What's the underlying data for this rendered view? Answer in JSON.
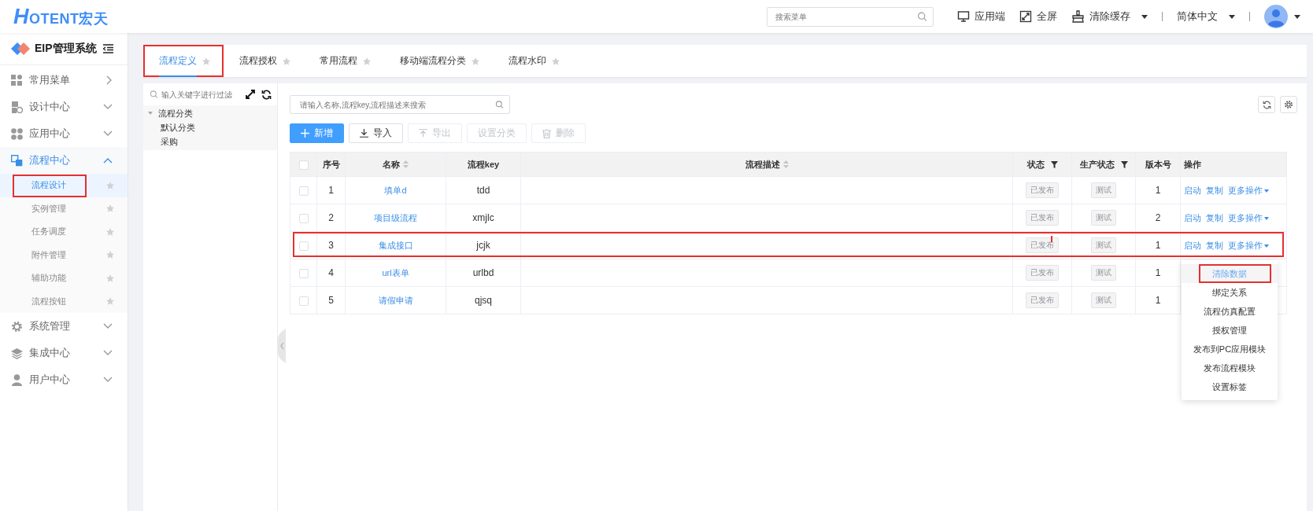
{
  "header": {
    "logo": "HOTENT宏天",
    "search": {
      "placeholder": "搜索菜单"
    },
    "actions": [
      {
        "label": "应用端",
        "kind": "button"
      },
      {
        "label": "全屏",
        "kind": "button"
      },
      {
        "label": "清除缓存",
        "kind": "menu"
      }
    ],
    "language": {
      "label": "简体中文",
      "expanded": false
    }
  },
  "sidebar": {
    "title": "EIP管理系统",
    "items": [
      {
        "label": "常用菜单",
        "kind": "flyout",
        "expanded": false
      },
      {
        "label": "设计中心",
        "kind": "group",
        "expanded": false
      },
      {
        "label": "应用中心",
        "kind": "group",
        "expanded": false
      },
      {
        "label": "流程中心",
        "kind": "group",
        "expanded": true,
        "children": [
          {
            "label": "流程设计",
            "selected": true,
            "highlighted": true
          },
          {
            "label": "实例管理",
            "selected": false,
            "highlighted": false
          },
          {
            "label": "任务调度",
            "selected": false,
            "highlighted": false
          },
          {
            "label": "附件管理",
            "selected": false,
            "highlighted": false
          },
          {
            "label": "辅助功能",
            "selected": false,
            "highlighted": false
          },
          {
            "label": "流程按钮",
            "selected": false,
            "highlighted": false
          }
        ]
      },
      {
        "label": "系统管理",
        "kind": "group",
        "expanded": false
      },
      {
        "label": "集成中心",
        "kind": "group",
        "expanded": false
      },
      {
        "label": "用户中心",
        "kind": "group",
        "expanded": false
      }
    ]
  },
  "tabs": [
    {
      "label": "流程定义",
      "selected": true,
      "highlighted": true
    },
    {
      "label": "流程授权",
      "selected": false,
      "highlighted": false
    },
    {
      "label": "常用流程",
      "selected": false,
      "highlighted": false
    },
    {
      "label": "移动端流程分类",
      "selected": false,
      "highlighted": false
    },
    {
      "label": "流程水印",
      "selected": false,
      "highlighted": false
    }
  ],
  "tree": {
    "filter": {
      "placeholder": "输入关键字进行过滤"
    },
    "nodes": [
      {
        "label": "流程分类",
        "expanded": true,
        "children": [
          {
            "label": "默认分类"
          },
          {
            "label": "采购"
          }
        ]
      }
    ]
  },
  "table": {
    "search": {
      "placeholder": "请输入名称,流程key,流程描述来搜索"
    },
    "toolbar": [
      {
        "label": "新增",
        "kind": "primary",
        "disabled": false
      },
      {
        "label": "导入",
        "kind": "default",
        "disabled": false
      },
      {
        "label": "导出",
        "kind": "default",
        "disabled": true
      },
      {
        "label": "设置分类",
        "kind": "default",
        "disabled": true
      },
      {
        "label": "删除",
        "kind": "default",
        "disabled": true
      }
    ],
    "columns": [
      {
        "kind": "checkbox",
        "checked": false
      },
      {
        "label": "序号",
        "kind": "plain"
      },
      {
        "label": "名称",
        "kind": "sortable"
      },
      {
        "label": "流程key",
        "kind": "plain"
      },
      {
        "label": "流程描述",
        "kind": "sortable"
      },
      {
        "label": "状态",
        "kind": "filter"
      },
      {
        "label": "生产状态",
        "kind": "filter"
      },
      {
        "label": "版本号",
        "kind": "plain"
      },
      {
        "label": "操作",
        "kind": "plain"
      }
    ],
    "rows": [
      {
        "checked": false,
        "index": "1",
        "name": "填单d",
        "key": "tdd",
        "status": "已发布",
        "production": "测试",
        "version": "1",
        "actions": [
          "启动",
          "复制",
          "更多操作"
        ],
        "highlighted": false
      },
      {
        "checked": false,
        "index": "2",
        "name": "项目级流程",
        "key": "xmjlc",
        "status": "已发布",
        "production": "测试",
        "version": "2",
        "actions": [
          "启动",
          "复制",
          "更多操作"
        ],
        "highlighted": false
      },
      {
        "checked": false,
        "index": "3",
        "name": "集成接口",
        "key": "jcjk",
        "status": "已发布",
        "production": "测试",
        "version": "1",
        "actions": [
          "启动",
          "复制",
          "更多操作"
        ],
        "highlighted": true
      },
      {
        "checked": false,
        "index": "4",
        "name": "url表单",
        "key": "urlbd",
        "status": "已发布",
        "production": "测试",
        "version": "1",
        "actions": [],
        "highlighted": false
      },
      {
        "checked": false,
        "index": "5",
        "name": "请假申请",
        "key": "qjsq",
        "status": "已发布",
        "production": "测试",
        "version": "1",
        "actions": [],
        "highlighted": false
      }
    ]
  },
  "more_menu": {
    "items": [
      {
        "label": "清除数据",
        "selected": true,
        "highlighted": true
      },
      {
        "label": "绑定关系",
        "selected": false,
        "highlighted": false
      },
      {
        "label": "流程仿真配置",
        "selected": false,
        "highlighted": false
      },
      {
        "label": "授权管理",
        "selected": false,
        "highlighted": false
      },
      {
        "label": "发布到PC应用模块",
        "selected": false,
        "highlighted": false
      },
      {
        "label": "发布流程模块",
        "selected": false,
        "highlighted": false
      },
      {
        "label": "设置标签",
        "selected": false,
        "highlighted": false
      }
    ]
  }
}
